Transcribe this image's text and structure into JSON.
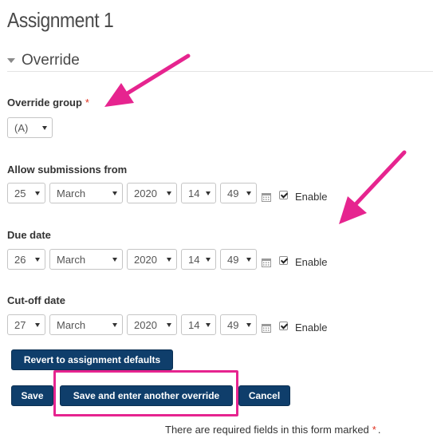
{
  "page": {
    "title": "Assignment 1"
  },
  "section": {
    "title": "Override"
  },
  "override_group": {
    "label": "Override group",
    "value": "(A)"
  },
  "required_marker": "*",
  "allow_submissions_from": {
    "label": "Allow submissions from",
    "day": "25",
    "month": "March",
    "year": "2020",
    "hour": "14",
    "minute": "49",
    "enable_label": "Enable",
    "enabled": true
  },
  "due_date": {
    "label": "Due date",
    "day": "26",
    "month": "March",
    "year": "2020",
    "hour": "14",
    "minute": "49",
    "enable_label": "Enable",
    "enabled": true
  },
  "cutoff_date": {
    "label": "Cut-off date",
    "day": "27",
    "month": "March",
    "year": "2020",
    "hour": "14",
    "minute": "49",
    "enable_label": "Enable",
    "enabled": true
  },
  "buttons": {
    "revert": "Revert to assignment defaults",
    "save": "Save",
    "save_another": "Save and enter another override",
    "cancel": "Cancel"
  },
  "footnote": {
    "text": "There are required fields in this form marked",
    "marker": "*",
    "end": "."
  },
  "colors": {
    "button": "#0f3e6b",
    "annotation": "#e6248f",
    "required": "#e0301e"
  },
  "icons": {
    "section_toggle": "caret-down-icon",
    "calendar": "calendar-icon",
    "checkbox": "checkbox-checked-icon"
  }
}
